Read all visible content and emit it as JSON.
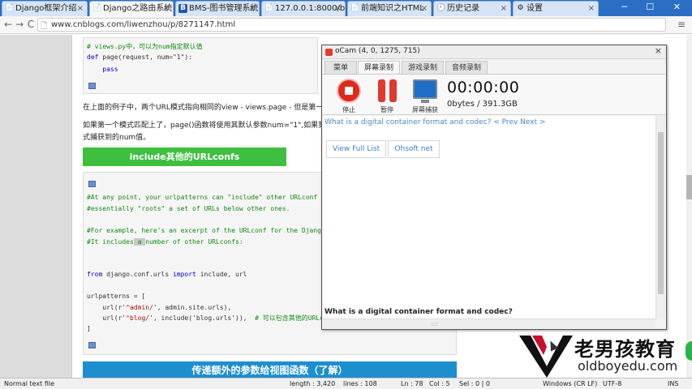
{
  "browser": {
    "tabs": [
      {
        "label": "Django框架介绍",
        "icon": "📄"
      },
      {
        "label": "Django之路由系统",
        "icon": "📄"
      },
      {
        "label": "BMS-图书管理系统",
        "icon": "B"
      },
      {
        "label": "127.0.0.1:8000/b",
        "icon": "📄"
      },
      {
        "label": "前端知识之HTML",
        "icon": "📄"
      },
      {
        "label": "历史记录",
        "icon": "🕘"
      },
      {
        "label": "设置",
        "icon": "⚙"
      }
    ],
    "tab_close_glyph": "×",
    "window_controls": "─ ☐ ✕",
    "url": "www.cnblogs.com/liwenzhou/p/8271147.html",
    "back_glyph": "←",
    "forward_glyph": "→",
    "reload_glyph": "C",
    "menu_glyph": "≡"
  },
  "article": {
    "code1": {
      "line1": "# views.py中，可以为num指定默认值",
      "line2_kw": "def",
      "line2_rest": " page(request, num=\"1\"):",
      "line3": "    pass"
    },
    "para1": "在上面的例子中，两个URL模式指向相同的view - views.page - 但是第一",
    "para2": "如果第一个模式匹配上了，page()函数将使用其默认参数num=\"1\",如果第",
    "para3": "式捕获到的num值。",
    "green_heading": "include其他的URLconfs",
    "code2": {
      "l1": "#At any point, your urlpatterns can \"include\" other URLconf",
      "l2": "#essentially \"roots\" a set of URLs below other ones.",
      "l3": "#For example, here's an excerpt of the URLconf for the Djang",
      "l4a": "#It includes",
      "l4b": " a ",
      "l4c": "number of other URLconfs:",
      "l5_kw1": "from",
      "l5_mid": " django.conf.urls ",
      "l5_kw2": "import",
      "l5_rest": " include, url",
      "l6": "urlpatterns = [",
      "l7a": "    url(r'",
      "l7s": "^admin/",
      "l7b": "', admin.site.urls),",
      "l8a": "    url(r'",
      "l8s": "^blog/",
      "l8b": "', include('blog.urls')),  ",
      "l8c": "# 可以包含其他的URLc",
      "l9": "]"
    },
    "blue_heading": "传递额外的参数给视图函数（了解）"
  },
  "ocam": {
    "title": "oCam (4, 0, 1275, 715)",
    "close_glyph": "×",
    "tabs": [
      "菜单",
      "屏幕录制",
      "游戏录制",
      "音频录制"
    ],
    "toolbar": {
      "stop_label": "停止",
      "pause_label": "暂停",
      "capture_label": "屏幕捕获"
    },
    "timer": "00:00:00",
    "storage": "0bytes / 391.3GB",
    "content": {
      "link_text": "What is a digital container format and codec?",
      "prev_next": "< Prev Next >",
      "btn_view_full": "View Full List",
      "btn_ohsoft": "Ohsoft net",
      "bottom_text": "What is a digital container format and codec?",
      "grip": "::::"
    }
  },
  "watermark": {
    "title": "老男孩教育",
    "url": "oldboyedu.com"
  },
  "statusbar": {
    "type": "Normal text file",
    "length": "length : 3,420",
    "lines": "lines : 108",
    "ln": "Ln : 78",
    "col": "Col : 5",
    "sel": "Sel : 0 | 0",
    "eol": "Windows (CR LF)",
    "encoding": "UTF-8",
    "mode": "INS"
  },
  "colors": {
    "green_heading": "#3fbf3f",
    "blue_heading": "#1d8fcf",
    "link": "#4a86c8",
    "stop": "#dd2a1c"
  }
}
